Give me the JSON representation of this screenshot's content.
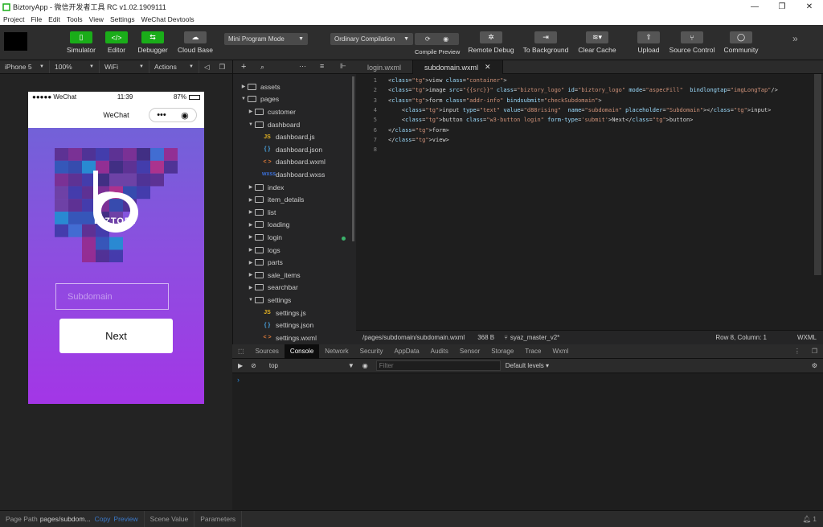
{
  "window": {
    "title": "BiztoryApp - 微信开发者工具 RC v1.02.1909111",
    "min": "—",
    "max": "❐",
    "close": "✕"
  },
  "menu": [
    "Project",
    "File",
    "Edit",
    "Tools",
    "View",
    "Settings",
    "WeChat Devtools"
  ],
  "toolbar": {
    "simulator": "Simulator",
    "editor": "Editor",
    "debugger": "Debugger",
    "cloud": "Cloud Base",
    "mode": "Mini Program Mode",
    "compile": "Ordinary Compilation",
    "compile_preview": "Compile Preview",
    "remote_debug": "Remote Debug",
    "to_background": "To Background",
    "clear_cache": "Clear Cache",
    "upload": "Upload",
    "source_control": "Source Control",
    "community": "Community"
  },
  "sim": {
    "device": "iPhone 5",
    "zoom": "100%",
    "network": "WiFi",
    "actions": "Actions"
  },
  "phone": {
    "carrier": "●●●●● WeChat",
    "time": "11:39",
    "battery": "87%",
    "nav_title": "WeChat",
    "brand": "BIZTORY",
    "input_placeholder": "Subdomain",
    "next": "Next"
  },
  "tree": [
    {
      "label": "assets",
      "type": "folder",
      "open": false,
      "depth": 0
    },
    {
      "label": "pages",
      "type": "folder",
      "open": true,
      "depth": 0
    },
    {
      "label": "customer",
      "type": "folder",
      "open": false,
      "depth": 1
    },
    {
      "label": "dashboard",
      "type": "folder",
      "open": true,
      "depth": 1
    },
    {
      "label": "dashboard.js",
      "type": "js",
      "depth": 2
    },
    {
      "label": "dashboard.json",
      "type": "json",
      "depth": 2
    },
    {
      "label": "dashboard.wxml",
      "type": "wxml",
      "depth": 2
    },
    {
      "label": "dashboard.wxss",
      "type": "wxss",
      "depth": 2
    },
    {
      "label": "index",
      "type": "folder",
      "open": false,
      "depth": 1
    },
    {
      "label": "item_details",
      "type": "folder",
      "open": false,
      "depth": 1
    },
    {
      "label": "list",
      "type": "folder",
      "open": false,
      "depth": 1
    },
    {
      "label": "loading",
      "type": "folder",
      "open": false,
      "depth": 1
    },
    {
      "label": "login",
      "type": "folder",
      "open": false,
      "depth": 1
    },
    {
      "label": "logs",
      "type": "folder",
      "open": false,
      "depth": 1
    },
    {
      "label": "parts",
      "type": "folder",
      "open": false,
      "depth": 1
    },
    {
      "label": "sale_items",
      "type": "folder",
      "open": false,
      "depth": 1
    },
    {
      "label": "searchbar",
      "type": "folder",
      "open": false,
      "depth": 1
    },
    {
      "label": "settings",
      "type": "folder",
      "open": true,
      "depth": 1
    },
    {
      "label": "settings.js",
      "type": "js",
      "depth": 2
    },
    {
      "label": "settings.json",
      "type": "json",
      "depth": 2
    },
    {
      "label": "settings.wxml",
      "type": "wxml",
      "depth": 2
    }
  ],
  "tabs": [
    "login.wxml",
    "subdomain.wxml"
  ],
  "code": [
    "<view class=\"container\">",
    "<image src=\"{{src}}\" class=\"biztory_logo\" id=\"biztory_logo\" mode=\"aspecFill\"  bindlongtap=\"imgLongTap\"/>",
    "<form class=\"addr-info\" bindsubmit=\"checkSubdomain\">",
    "    <input type=\"text\" value=\"d88rising\"  name=\"subdomain\" placeholder=\"Subdomain\"></input>",
    "    <button class=\"w3-button login\" form-type='submit'>Next</button>",
    "</form>",
    "</view>",
    ""
  ],
  "status": {
    "path": "/pages/subdomain/subdomain.wxml",
    "size": "368 B",
    "branch": "syaz_master_v2*",
    "pos": "Row 8, Column: 1",
    "lang": "WXML"
  },
  "devtools_tabs": [
    "Sources",
    "Console",
    "Network",
    "Security",
    "AppData",
    "Audits",
    "Sensor",
    "Storage",
    "Trace",
    "Wxml"
  ],
  "console": {
    "context": "top",
    "filter_placeholder": "Filter",
    "levels": "Default levels ▾",
    "prompt": "›"
  },
  "bottom": {
    "page_path_label": "Page Path",
    "page_path": "pages/subdom...",
    "copy": "Copy",
    "preview": "Preview",
    "scene": "Scene Value",
    "params": "Parameters",
    "alerts": "1"
  }
}
